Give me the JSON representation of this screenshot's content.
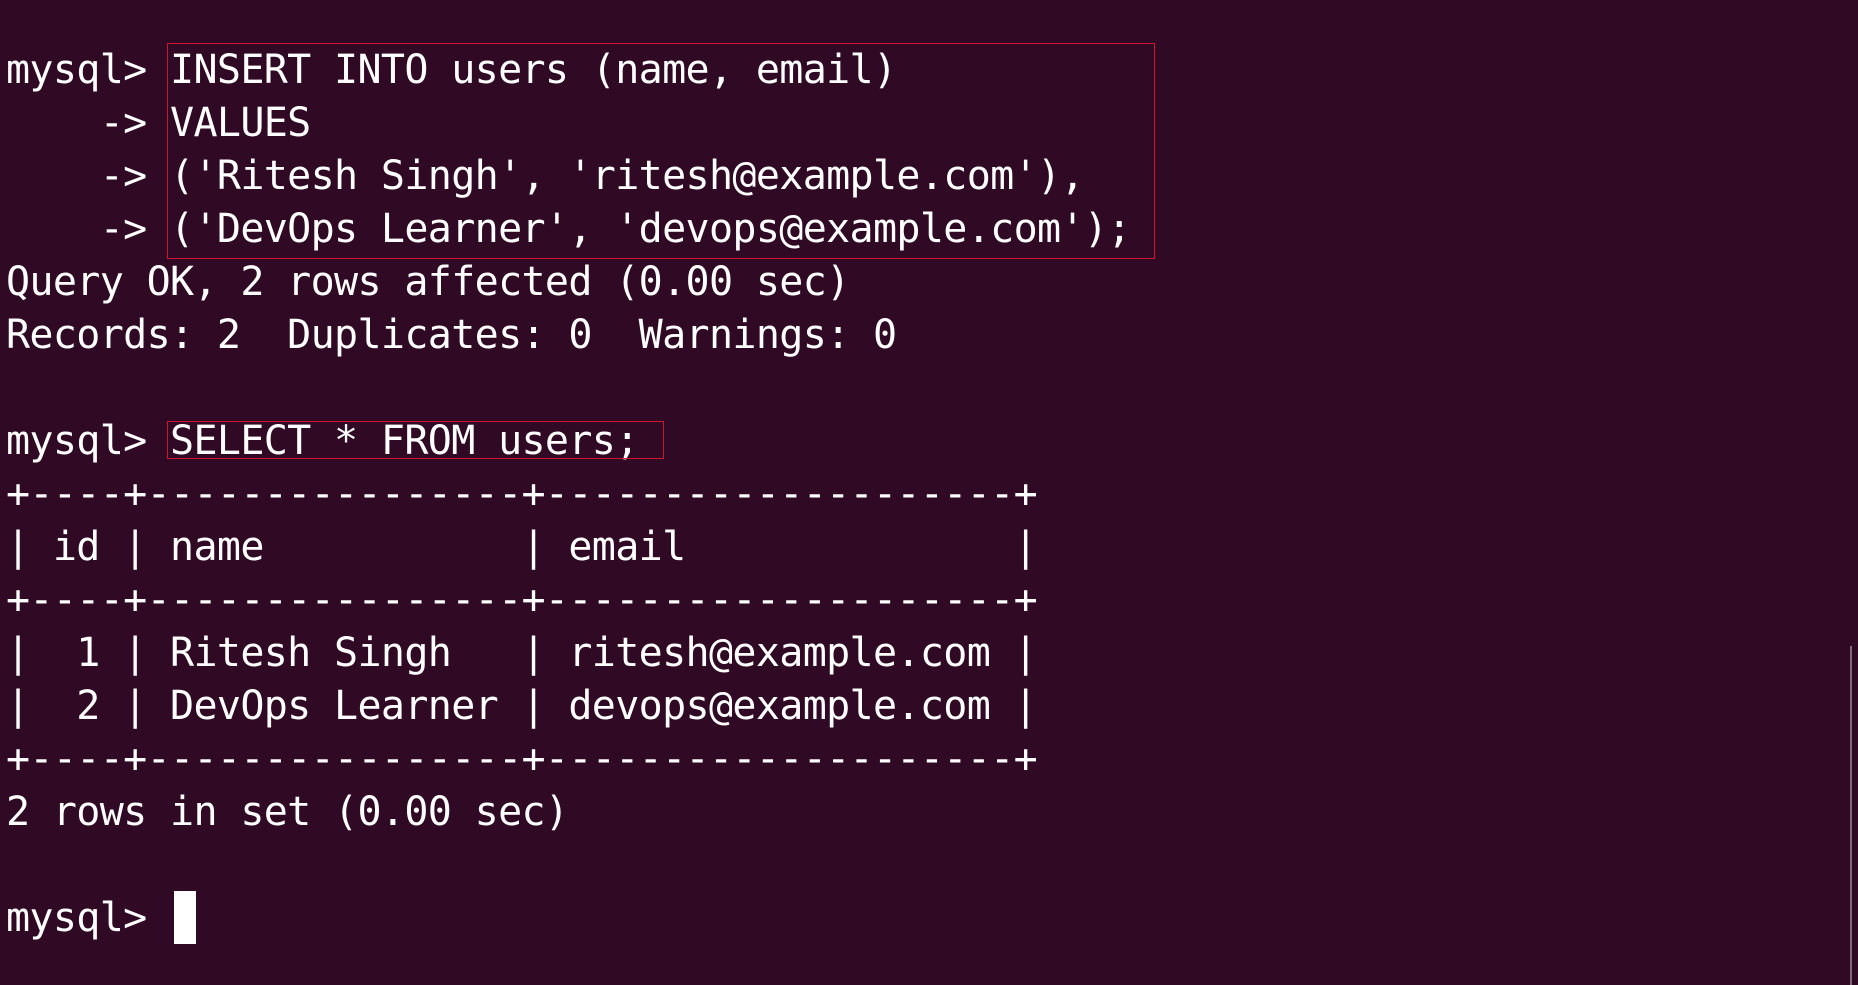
{
  "terminal": {
    "lines": [
      "mysql> INSERT INTO users (name, email)",
      "    -> VALUES",
      "    -> ('Ritesh Singh', 'ritesh@example.com'),",
      "    -> ('DevOps Learner', 'devops@example.com');",
      "Query OK, 2 rows affected (0.00 sec)",
      "Records: 2  Duplicates: 0  Warnings: 0",
      "",
      "mysql> SELECT * FROM users;",
      "+----+----------------+--------------------+",
      "| id | name           | email              |",
      "+----+----------------+--------------------+",
      "|  1 | Ritesh Singh   | ritesh@example.com |",
      "|  2 | DevOps Learner | devops@example.com |",
      "+----+----------------+--------------------+",
      "2 rows in set (0.00 sec)",
      "",
      "mysql> "
    ]
  },
  "colors": {
    "background": "#300a24",
    "text": "#ffffff",
    "highlight_border": "#d01530"
  }
}
